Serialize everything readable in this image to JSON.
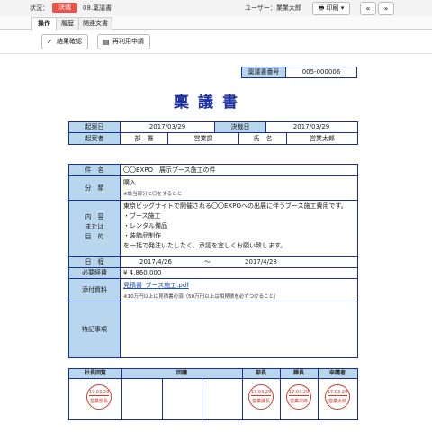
{
  "topbar": {
    "status_label": "状況：",
    "status_badge": "決裁",
    "doc_code": "08.稟議書",
    "user": "ユーザー：業業太郎",
    "print_label": "印刷",
    "prev": "«",
    "next": "»"
  },
  "tabs": [
    "操作",
    "履歴",
    "関連文書"
  ],
  "actions": {
    "result_confirm": "結果確認",
    "reuse_apply": "再利用申請"
  },
  "doc": {
    "number_label": "稟議書番号",
    "number_value": "005-000006",
    "title": "稟議書",
    "created_label": "起案日",
    "created_value": "2017/03/29",
    "decided_label": "決裁日",
    "decided_value": "2017/03/29",
    "drafter_label": "起案者",
    "dept_label": "部　署",
    "dept_value": "営業課",
    "name_label": "氏　名",
    "name_value": "営業太郎",
    "subject_label": "件　名",
    "subject_value": "〇〇EXPO　展示ブース施工の件",
    "category_label": "分　類",
    "category_value": "購入",
    "category_note": "※該当部分に〇をすること",
    "content_label_1": "内　容",
    "content_label_2": "または",
    "content_label_3": "目　的",
    "content_lines": [
      "東京ビッグサイトで開催される〇〇EXPOへの出展に伴うブース施工費用です。",
      "・ブース施工",
      "・レンタル備品",
      "・装飾品制作",
      "を一括で発注いたしたく、承認を宜しくお願い致します。"
    ],
    "schedule_label": "日　程",
    "schedule_start": "2017/4/26",
    "schedule_sep": "〜",
    "schedule_end": "2017/4/28",
    "cost_label": "必要経費",
    "cost_value": "¥ 4,860,000",
    "attach_label": "添付資料",
    "attach_link": "見積書_ブース施工.pdf",
    "attach_note": "※10万円以上は見積書必須（50万円以上は相見積を必ずつけること）",
    "notes_label": "特記事項",
    "approval": {
      "president": "社長回覧",
      "circulation": "回議",
      "manager": "部長",
      "section_chief": "課長",
      "applicant": "申請者"
    },
    "stamps": [
      {
        "date": "17.03.29",
        "name": "営業部長"
      },
      {
        "date": "17.03.29",
        "name": "営業課長"
      },
      {
        "date": "17.03.29",
        "name": "営業次郎"
      },
      {
        "date": "17.03.29",
        "name": "営業太郎"
      }
    ]
  }
}
